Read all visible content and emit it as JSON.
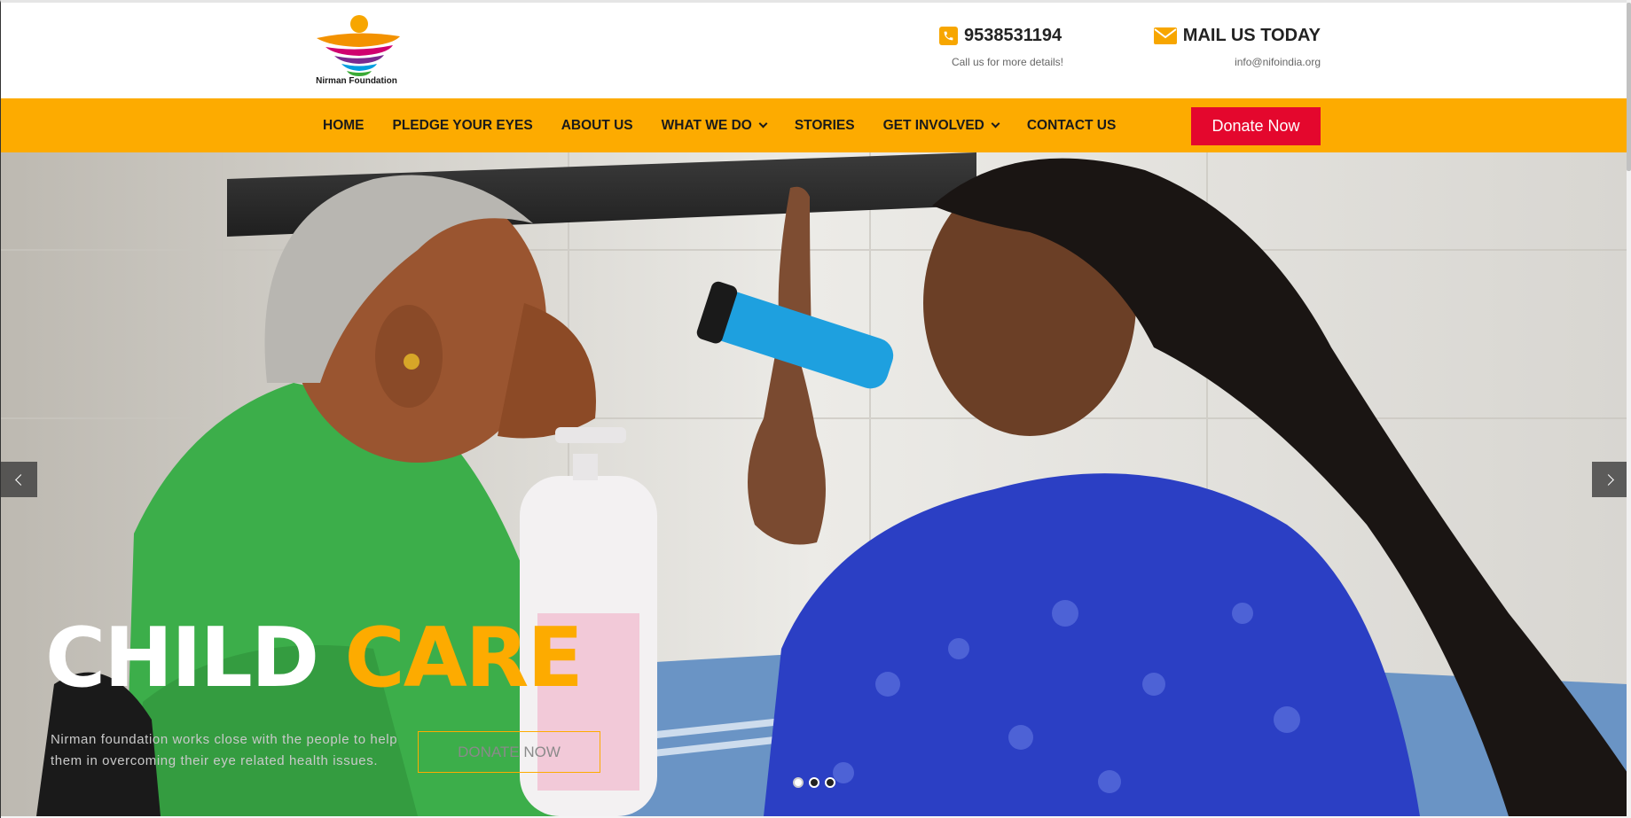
{
  "brand": {
    "name": "Nirman Foundation"
  },
  "header": {
    "phone": {
      "number": "9538531194",
      "subtext": "Call us for more details!"
    },
    "mail": {
      "label": "MAIL US TODAY",
      "subtext": "info@nifoindia.org"
    }
  },
  "nav": {
    "items": [
      {
        "label": "HOME",
        "dropdown": false
      },
      {
        "label": "PLEDGE YOUR EYES",
        "dropdown": false
      },
      {
        "label": "ABOUT US",
        "dropdown": false
      },
      {
        "label": "WHAT WE DO",
        "dropdown": true
      },
      {
        "label": "STORIES",
        "dropdown": false
      },
      {
        "label": "GET INVOLVED",
        "dropdown": true
      },
      {
        "label": "CONTACT US",
        "dropdown": false
      }
    ],
    "donate_label": "Donate Now"
  },
  "hero": {
    "title_white": "CHILD",
    "title_orange": "CARE",
    "text": "Nirman foundation works close with the people to help them in overcoming their eye related health issues.",
    "cta_label": "DONATE NOW",
    "slides_count": 3,
    "active_slide": 1
  },
  "colors": {
    "accent": "#fdab00",
    "donate": "#e4072d",
    "text_dark": "#1a1a1a"
  }
}
